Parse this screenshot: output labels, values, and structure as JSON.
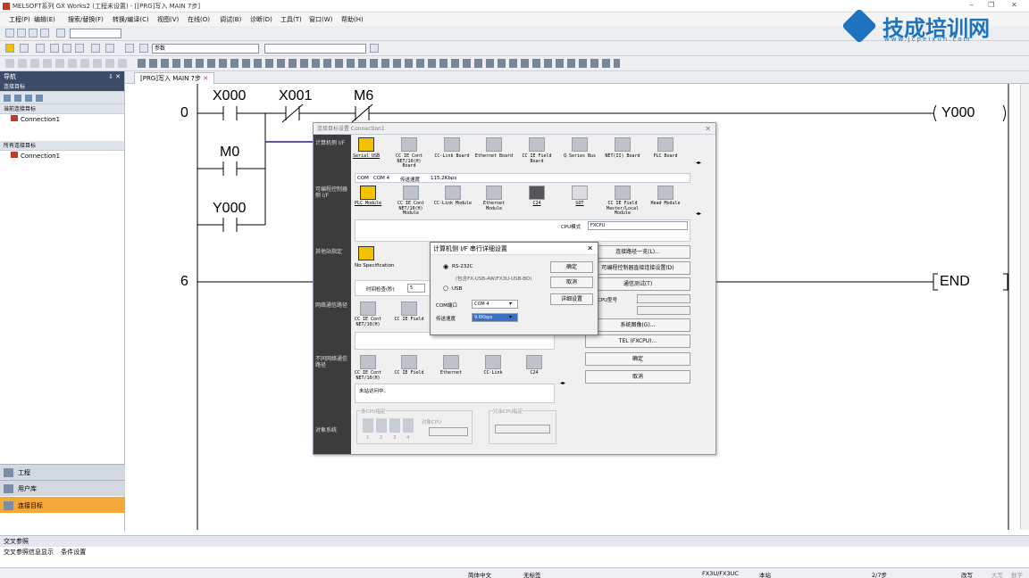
{
  "window": {
    "title": "MELSOFT系列 GX Works2 (工程未设置) - [[PRG]写入 MAIN 7步]",
    "controls": [
      "‒",
      "❐",
      "✕"
    ]
  },
  "menubar": [
    "工程(P)",
    "编辑(E)",
    "搜索/替换(F)",
    "转换/编译(C)",
    "视图(V)",
    "在线(O)",
    "调试(B)",
    "诊断(D)",
    "工具(T)",
    "窗口(W)",
    "帮助(H)"
  ],
  "toolbar": {
    "combo_main": "",
    "combo_search": "参数"
  },
  "logo": {
    "text": "技成培训网",
    "url": "www.jcpeixun.com"
  },
  "nav": {
    "title": "导航",
    "pin": "⇩ ✕",
    "subtitle": "连接目标",
    "current_header": "当前连接目标",
    "current_item": "Connection1",
    "all_header": "所有连接目标",
    "all_item": "Connection1",
    "buttons": [
      "工程",
      "用户库",
      "连接目标"
    ]
  },
  "editor": {
    "tab": "[PRG]写入 MAIN 7步",
    "rung0": "0",
    "rung6": "6",
    "contacts": [
      "X000",
      "X001",
      "M6",
      "M0",
      "Y000"
    ],
    "coil": "Y000",
    "end": "END"
  },
  "conn_dialog": {
    "title": "连接目标设置 Connection1",
    "side_labels": [
      "计算机侧 I/F",
      "可编程控制器侧 I/F",
      "其他站指定",
      "网络通信路径",
      "不同网络通信路径",
      "对象系统"
    ],
    "pc_if": [
      "Serial USB",
      "CC IE Cont NET/10(H) Board",
      "CC-Link Board",
      "Ethernet Board",
      "CC IE Field Board",
      "Q Series Bus",
      "NET(II) Board",
      "PLC Board"
    ],
    "pc_row": {
      "com_label": "COM",
      "com_value": "COM 4",
      "speed_label": "传送速度",
      "speed_value": "115.2Kbps"
    },
    "plc_if": [
      "PLC Module",
      "CC IE Cont NET/10(H) Module",
      "CC-Link Module",
      "Ethernet Module",
      "C24",
      "GOT",
      "CC IE Field Master/Local Module",
      "Head Module"
    ],
    "cpu_mode_label": "CPU模式",
    "cpu_mode_value": "FXCPU",
    "other_station": "No Specification",
    "timeout_label": "时间检查(秒)",
    "timeout_value": "5",
    "net_route": [
      "CC IE Cont NET/10(H)",
      "CC IE Field"
    ],
    "diff_net": [
      "CC IE Cont NET/10(H)",
      "CC IE Field",
      "Ethernet",
      "CC-Link",
      "C24"
    ],
    "status_text": "未站访问中。",
    "right_buttons": [
      "连接路径一览(L)...",
      "可编程控制器直接连接设置(D)",
      "通信测试(T)",
      "系统图像(G)...",
      "TEL (FXCPU)...",
      "确定",
      "取消"
    ],
    "cpu_type_label": "CPU型号",
    "multi_cpu": "多CPU指定",
    "target_cpu": "对象CPU",
    "redundant": "冗余CPU指定",
    "cpu_numbers": [
      "1",
      "2",
      "3",
      "4"
    ],
    "object_system": "对象系统"
  },
  "serial_dialog": {
    "title": "计算机侧 I/F 串行详细设置",
    "rs232c": "RS-232C",
    "rs232c_note": "(包含FX-USB-AW/FX3U-USB-BD)",
    "usb": "USB",
    "com_label": "COM端口",
    "com_value": "COM 4",
    "speed_label": "传送速度",
    "speed_value": "9.6Kbps",
    "buttons": [
      "确定",
      "取消",
      "详细设置"
    ]
  },
  "xref": {
    "title": "交叉参照",
    "tabs": [
      "交叉参照信息显示",
      "条件设置"
    ]
  },
  "statusbar": [
    "简体中文",
    "无标签",
    "FX3U/FX3UC",
    "本站",
    "2/7步",
    "改写",
    "大写",
    "数字"
  ]
}
